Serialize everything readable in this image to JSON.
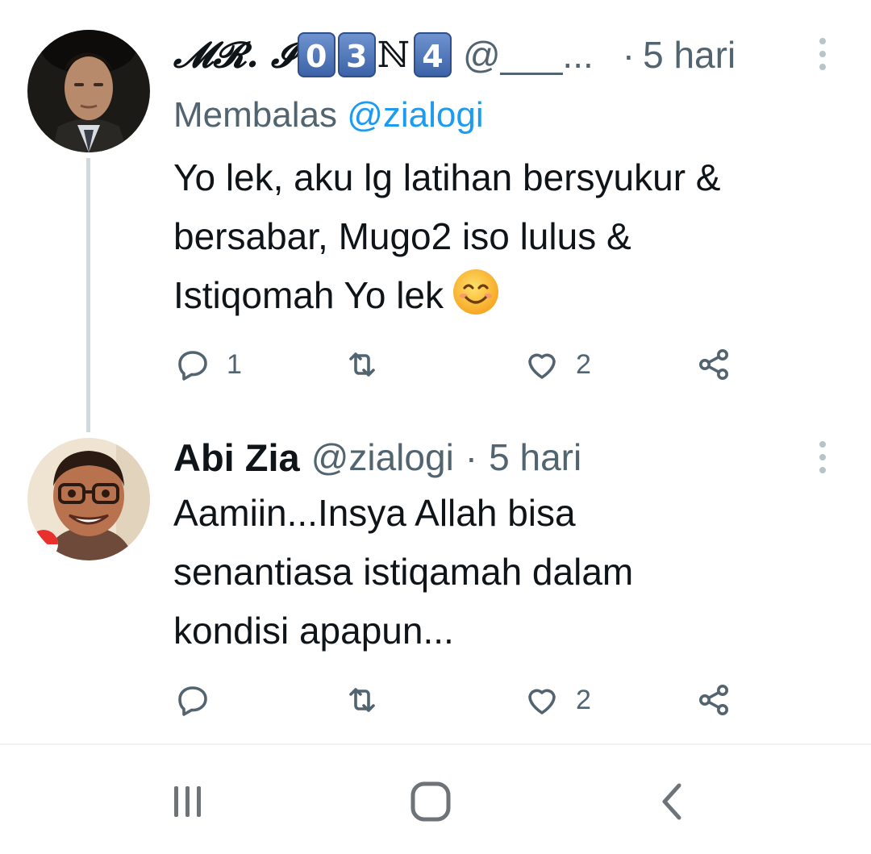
{
  "tweets": [
    {
      "author": {
        "name_script": "𝓜𝓡. 𝓘",
        "name_boxes": [
          "0",
          "3",
          "4"
        ],
        "name_letter": "ℕ",
        "handle": "@___...",
        "avatar_icon": "portrait-avatar"
      },
      "separator": "·",
      "time": "5 hari",
      "replying_prefix": "Membalas",
      "replying_to": "@zialogi",
      "text_lines": [
        "Yo lek, aku lg latihan bersyukur &",
        "bersabar, Mugo2 iso lulus &",
        "Istiqomah Yo lek"
      ],
      "emoji": "smiling-face-emoji",
      "actions": {
        "reply_count": "1",
        "retweet_count": "",
        "like_count": "2"
      }
    },
    {
      "author": {
        "name": "Abi Zia",
        "handle": "@zialogi",
        "avatar_icon": "cartoon-avatar"
      },
      "separator": "·",
      "time": "5 hari",
      "text_lines": [
        "Aamiin...Insya Allah bisa",
        "senantiasa istiqamah dalam",
        "kondisi apapun..."
      ],
      "actions": {
        "reply_count": "",
        "retweet_count": "",
        "like_count": "2"
      }
    }
  ],
  "navbar": {
    "buttons": [
      "recent-apps-icon",
      "home-icon",
      "back-icon"
    ]
  },
  "colors": {
    "accent": "#1d9bf0",
    "muted": "#536471",
    "text": "#0f1419",
    "thread_line": "#cfd9de"
  }
}
